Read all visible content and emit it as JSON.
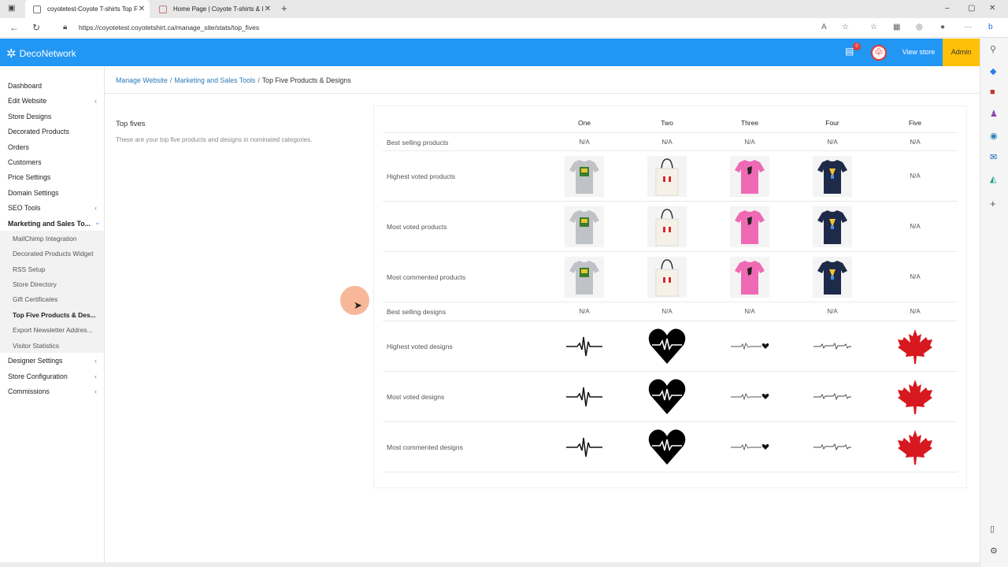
{
  "browser": {
    "tabs": [
      {
        "title": "coyotetest-Coyote T-shirts Top F",
        "active": true
      },
      {
        "title": "Home Page | Coyote T-shirts & I",
        "active": false
      }
    ],
    "url": "https://coyotetest.coyotetshirt.ca/manage_site/stats/top_fives"
  },
  "header": {
    "logo_text": "DecoNetwork",
    "notification_count": "0",
    "view_store": "View store",
    "admin": "Admin",
    "brand_color": "#2196f3",
    "admin_color": "#ffc107"
  },
  "sidebar": {
    "items": [
      {
        "label": "Dashboard"
      },
      {
        "label": "Edit Website"
      },
      {
        "label": "Store Designs"
      },
      {
        "label": "Decorated Products"
      },
      {
        "label": "Orders"
      },
      {
        "label": "Customers"
      },
      {
        "label": "Price Settings"
      },
      {
        "label": "Domain Settings"
      },
      {
        "label": "SEO Tools"
      },
      {
        "label": "Marketing and Sales To..."
      },
      {
        "label": "Designer Settings"
      },
      {
        "label": "Store Configuration"
      },
      {
        "label": "Commissions"
      }
    ],
    "subitems": [
      {
        "label": "MailChimp Integration"
      },
      {
        "label": "Decorated Products Widget"
      },
      {
        "label": "RSS Setup"
      },
      {
        "label": "Store Directory"
      },
      {
        "label": "Gift Certificates"
      },
      {
        "label": "Top Five Products & Des..."
      },
      {
        "label": "Export Newsletter Addres..."
      },
      {
        "label": "Visitor Statistics"
      }
    ]
  },
  "breadcrumb": {
    "manage": "Manage Website",
    "marketing": "Marketing and Sales Tools",
    "current": "Top Five Products & Designs"
  },
  "section": {
    "title": "Top fives",
    "description": "These are your top five products and designs in nominated categories."
  },
  "table": {
    "columns": [
      "One",
      "Two",
      "Three",
      "Four",
      "Five"
    ],
    "rows": [
      {
        "label": "Best selling products",
        "cells": [
          "N/A",
          "N/A",
          "N/A",
          "N/A",
          "N/A"
        ]
      },
      {
        "label": "Highest voted products",
        "cells": [
          "grey-tshirt",
          "tote-bag",
          "pink-tshirt",
          "navy-tshirt",
          "N/A"
        ]
      },
      {
        "label": "Most voted products",
        "cells": [
          "grey-tshirt",
          "tote-bag",
          "pink-tshirt",
          "navy-tshirt",
          "N/A"
        ]
      },
      {
        "label": "Most commented products",
        "cells": [
          "grey-tshirt",
          "tote-bag",
          "pink-tshirt",
          "navy-tshirt",
          "N/A"
        ]
      },
      {
        "label": "Best selling designs",
        "cells": [
          "N/A",
          "N/A",
          "N/A",
          "N/A",
          "N/A"
        ]
      },
      {
        "label": "Highest voted designs",
        "cells": [
          "heartbeat-line",
          "heartbeat-heart",
          "heartbeat-small-heart",
          "heartbeat-thin",
          "maple-leaf"
        ]
      },
      {
        "label": "Most voted designs",
        "cells": [
          "heartbeat-line",
          "heartbeat-heart",
          "heartbeat-small-heart",
          "heartbeat-thin",
          "maple-leaf"
        ]
      },
      {
        "label": "Most commented designs",
        "cells": [
          "heartbeat-line",
          "heartbeat-heart",
          "heartbeat-small-heart",
          "heartbeat-thin",
          "maple-leaf"
        ]
      }
    ]
  }
}
